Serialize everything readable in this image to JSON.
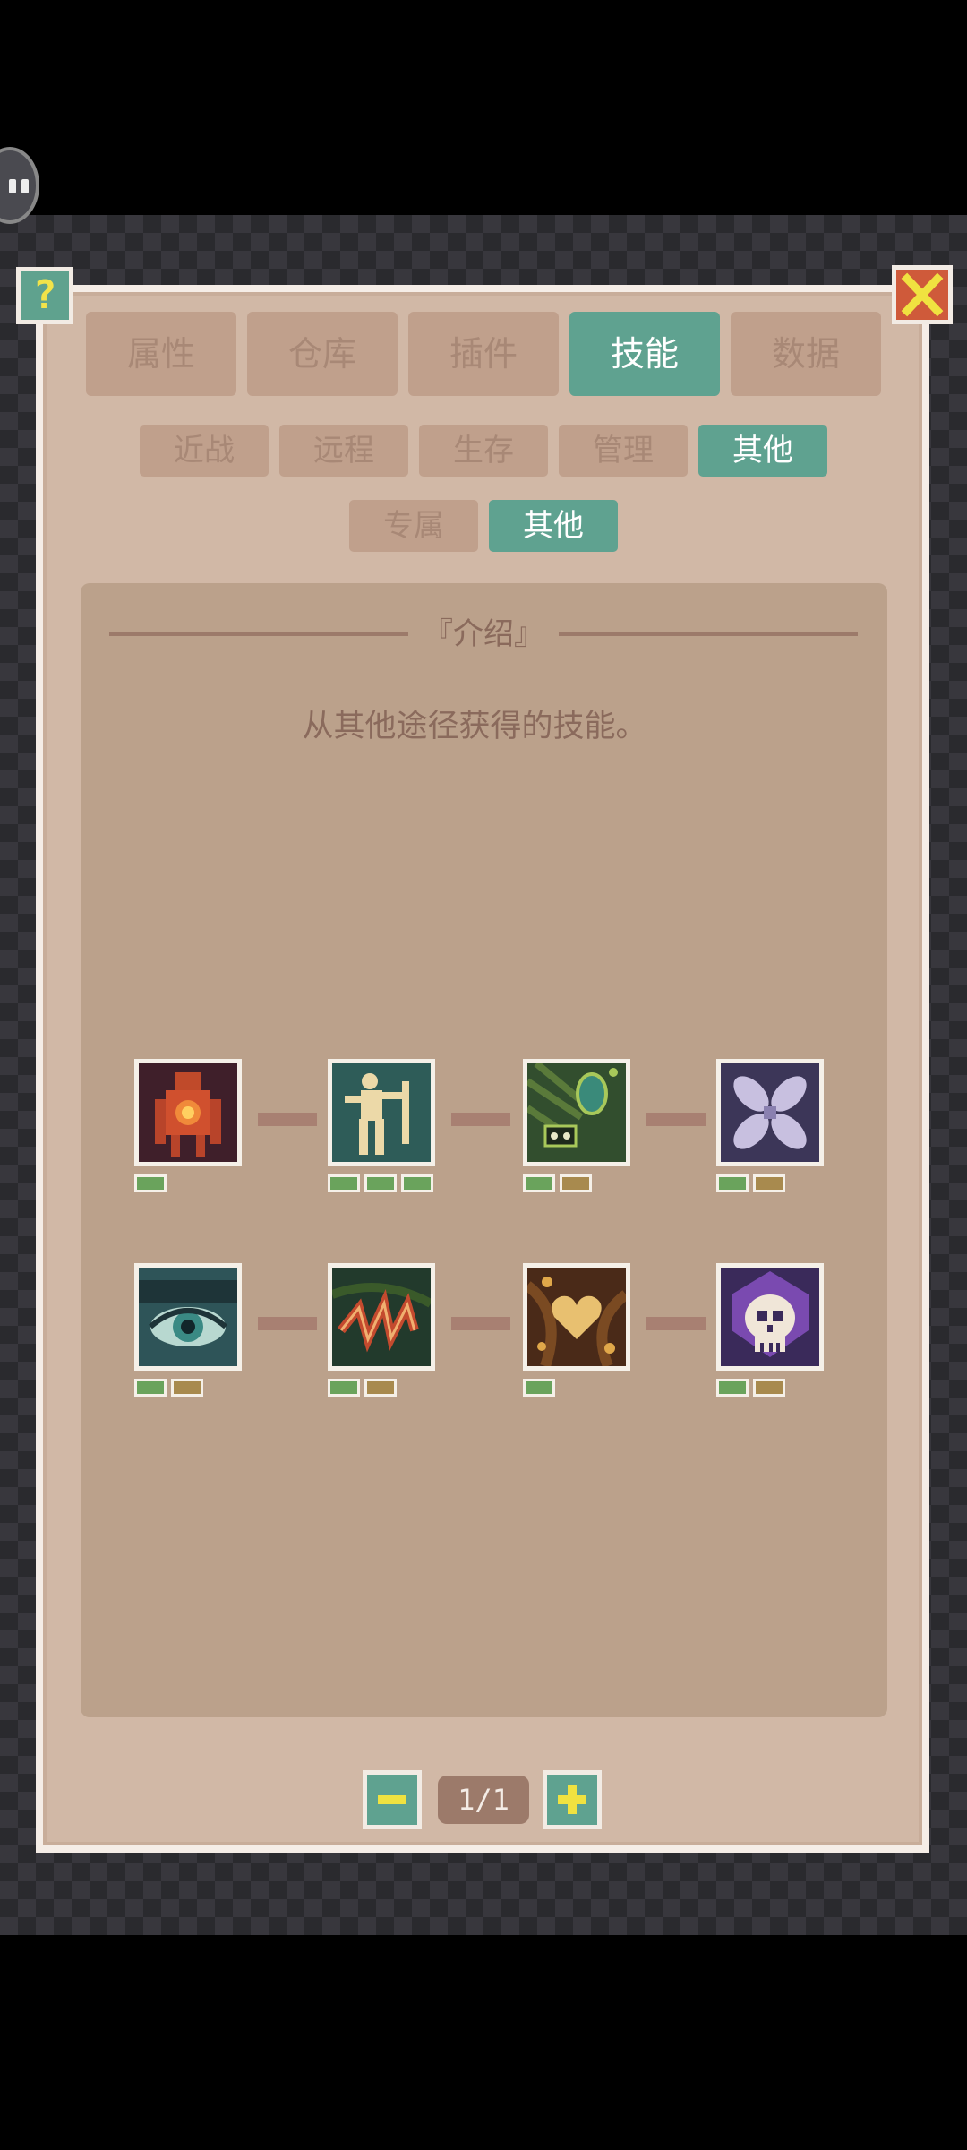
{
  "window": {
    "help_icon": "question-mark-icon",
    "close_icon": "close-x-icon",
    "help_label": "?"
  },
  "main_tabs": [
    {
      "label": "属性",
      "active": false
    },
    {
      "label": "仓库",
      "active": false
    },
    {
      "label": "插件",
      "active": false
    },
    {
      "label": "技能",
      "active": true
    },
    {
      "label": "数据",
      "active": false
    }
  ],
  "category_tabs": [
    {
      "label": "近战",
      "active": false
    },
    {
      "label": "远程",
      "active": false
    },
    {
      "label": "生存",
      "active": false
    },
    {
      "label": "管理",
      "active": false
    },
    {
      "label": "其他",
      "active": true
    }
  ],
  "sub_tabs": [
    {
      "label": "专属",
      "active": false
    },
    {
      "label": "其他",
      "active": true
    }
  ],
  "intro": {
    "title": "『介绍』",
    "description": "从其他途径获得的技能。"
  },
  "skills": [
    {
      "icon": "red-core-figure-icon",
      "levels": [
        "green"
      ]
    },
    {
      "icon": "cream-warrior-figure-icon",
      "levels": [
        "green",
        "green",
        "green"
      ]
    },
    {
      "icon": "green-chain-amulet-icon",
      "levels": [
        "green",
        "bronze"
      ]
    },
    {
      "icon": "purple-propeller-icon",
      "levels": [
        "green",
        "bronze"
      ]
    },
    {
      "icon": "teal-eye-icon",
      "levels": [
        "green",
        "bronze"
      ]
    },
    {
      "icon": "red-slash-claw-icon",
      "levels": [
        "green",
        "bronze"
      ]
    },
    {
      "icon": "golden-heart-icon",
      "levels": [
        "green"
      ]
    },
    {
      "icon": "purple-skull-icon",
      "levels": [
        "green",
        "bronze"
      ]
    }
  ],
  "pager": {
    "current": "1/1",
    "prev_icon": "minus-icon",
    "next_icon": "plus-icon"
  },
  "colors": {
    "panel": "#d1b8a6",
    "inner": "#bba18b",
    "accent": "#5fa290",
    "tab_inactive": "#c0a08c",
    "text_muted": "#a88876",
    "pip_green": "#6aa35c",
    "pip_bronze": "#a88a4e",
    "icon_yellow": "#f0e240"
  }
}
